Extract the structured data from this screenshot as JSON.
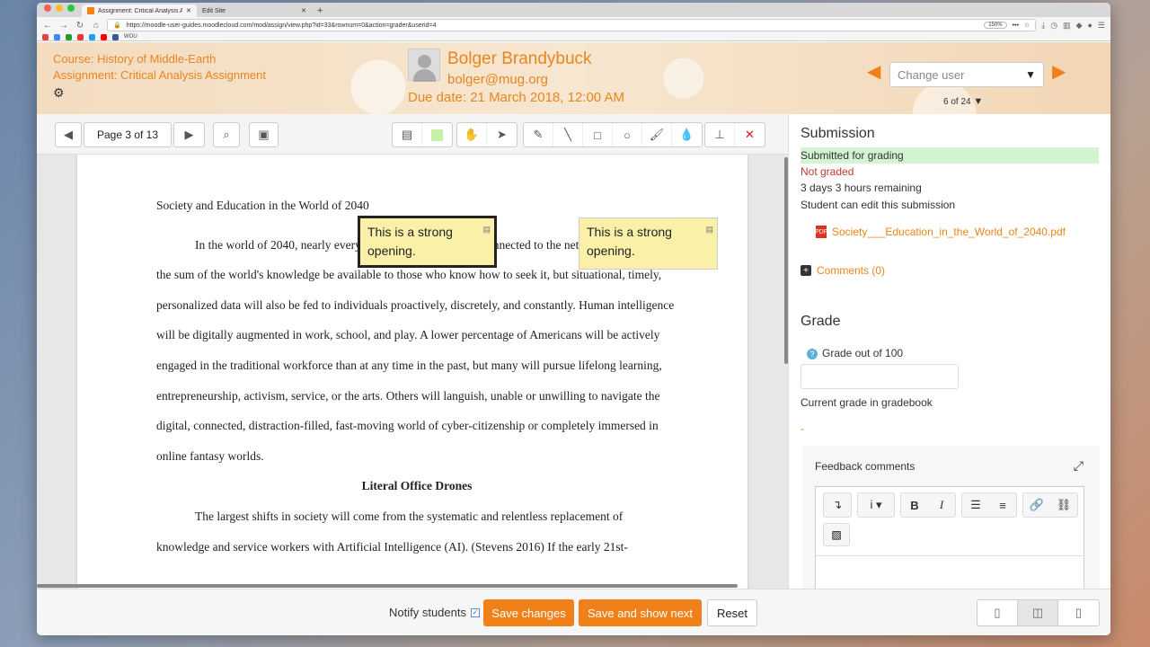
{
  "browser": {
    "tabs": [
      {
        "label": "Assignment: Critical Analysis A"
      },
      {
        "label": "Edit Site"
      }
    ],
    "url": "https://moodle-user-guides.moodlecloud.com/mod/assign/view.php?id=33&rownum=0&action=grader&userid=4",
    "zoom": "150%",
    "bookmark_label": "WOU"
  },
  "header": {
    "course": "Course: History of Middle-Earth",
    "assignment": "Assignment: Critical Analysis Assignment",
    "user_name": "Bolger Brandybuck",
    "user_email": "bolger@mug.org",
    "due_date": "Due date: 21 March 2018, 12:00 AM",
    "change_user_placeholder": "Change user",
    "user_count": "6 of 24"
  },
  "pdf_toolbar": {
    "page_label": "Page 3 of 13"
  },
  "document": {
    "title_line": "Society and Education in the World of 2040",
    "para1": "In the world of 2040, nearly everyone will be ubiquitously connected to the network. Not only will the sum of the world's knowledge be available to those who know how to seek it, but situational, timely, personalized data will also be fed to individuals proactively, discretely, and constantly. Human intelligence will be digitally augmented in work, school, and play. A lower percentage of Americans will be actively engaged in the traditional workforce than at any time in the past, but many will pursue lifelong learning, entrepreneurship, activism, service, or the arts. Others will languish, unable or unwilling to navigate the digital, connected, distraction-filled, fast-moving world of cyber-citizenship or completely immersed in online fantasy worlds.",
    "heading": "Literal Office Drones",
    "para2": "The largest shifts in society will come from the systematic and relentless replacement of knowledge and service workers with Artificial Intelligence (AI). (Stevens 2016) If the early 21st-"
  },
  "annotations": [
    {
      "text": "This is a strong opening."
    },
    {
      "text": "This is a strong opening."
    }
  ],
  "submission": {
    "heading": "Submission",
    "status": "Submitted for grading",
    "grading_status": "Not graded",
    "time_remaining": "3 days 3 hours remaining",
    "edit_note": "Student can edit this submission",
    "file_name": "Society___Education_in_the_World_of_2040.pdf",
    "comments": "Comments (0)"
  },
  "grade": {
    "heading": "Grade",
    "grade_label": "Grade out of 100",
    "current_label": "Current grade in gradebook",
    "current_value": "-",
    "feedback_label": "Feedback comments"
  },
  "footer": {
    "notify_label": "Notify students",
    "save_label": "Save changes",
    "save_next_label": "Save and show next",
    "reset_label": "Reset"
  }
}
